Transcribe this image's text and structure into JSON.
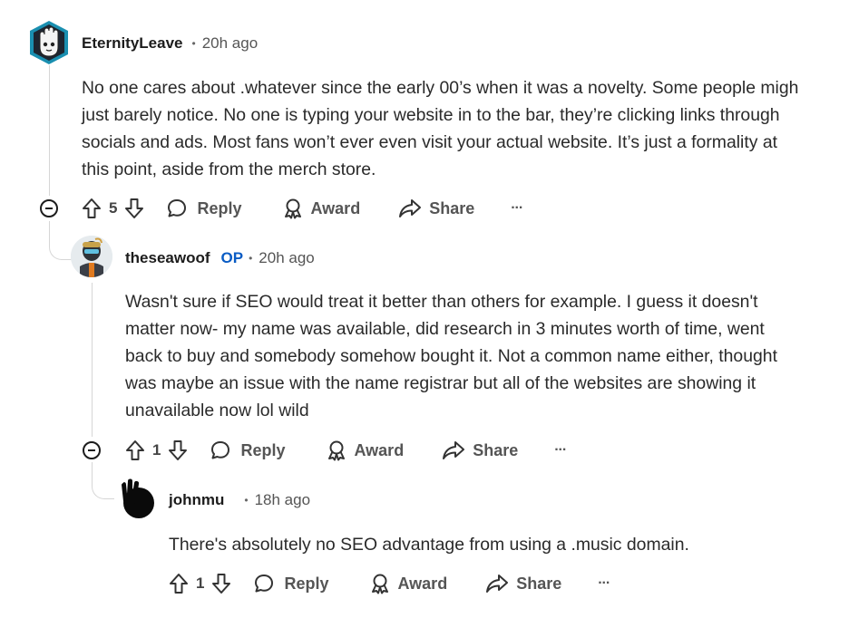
{
  "comments": [
    {
      "username": "EternityLeave",
      "time": "20h ago",
      "lines": [
        "No one cares about .whatever since the early 00’s when it was a novelty. Some people migh",
        "just barely notice. No one is typing your website in to the bar, they’re clicking links through",
        "socials and ads. Most fans won’t ever even visit your actual website. It’s just a formality at",
        "this point, aside from the merch store."
      ],
      "votes": "5",
      "reply_label": "Reply",
      "award_label": "Award",
      "share_label": "Share",
      "more_label": "···"
    },
    {
      "username": "theseawoof",
      "op_badge": "OP",
      "time": "20h ago",
      "lines": [
        "Wasn't sure if SEO would treat it better than others for example. I guess it doesn't",
        "matter now- my name was available, did research in 3 minutes worth of time, went",
        "back to buy and somebody somehow bought it. Not a common name either, thought",
        "was maybe an issue with the name registrar but all of the websites are showing it",
        "unavailable now lol wild"
      ],
      "votes": "1",
      "reply_label": "Reply",
      "award_label": "Award",
      "share_label": "Share",
      "more_label": "···"
    },
    {
      "username": "johnmu",
      "time": "18h ago",
      "lines": [
        "There's absolutely no SEO advantage from using a .music domain."
      ],
      "votes": "1",
      "reply_label": "Reply",
      "award_label": "Award",
      "share_label": "Share",
      "more_label": "···"
    }
  ]
}
